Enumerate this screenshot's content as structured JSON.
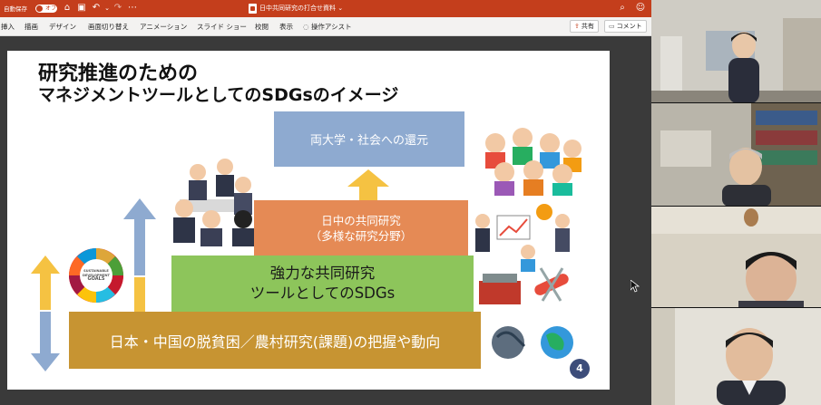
{
  "window": {
    "autosave_label": "自動保存",
    "autosave_state": "オフ",
    "doc_title": "日中共同研究の打合せ資料",
    "doc_title_suffix": "⌄"
  },
  "ribbon": {
    "tabs": [
      "挿入",
      "描画",
      "デザイン",
      "画面切り替え",
      "アニメーション",
      "スライド ショー",
      "校閲",
      "表示",
      "操作アシスト"
    ],
    "share_label": "共有",
    "comment_label": "コメント"
  },
  "slide": {
    "title_line1": "研究推進のための",
    "title_line2": "マネジメントツールとしてのSDGsのイメージ",
    "box1": "両大学・社会への還元",
    "box2_line1": "日中の共同研究",
    "box2_line2": "（多様な研究分野）",
    "box3_line1": "強力な共同研究",
    "box3_line2": "ツールとしてのSDGs",
    "box4": "日本・中国の脱貧困／農村研究(課題)の把握や動向",
    "sdgs_text_1": "SUSTAINABLE",
    "sdgs_text_2": "DEVELOPMENT",
    "sdgs_text_3": "GOALS",
    "page_number": "4"
  },
  "colors": {
    "titlebar": "#c43e1c",
    "box1": "#8eaad0",
    "box2": "#e58a55",
    "box3": "#8dc55b",
    "box4": "#c79432",
    "arrow_yellow": "#f5c242",
    "arrow_blue": "#8eaad0"
  }
}
